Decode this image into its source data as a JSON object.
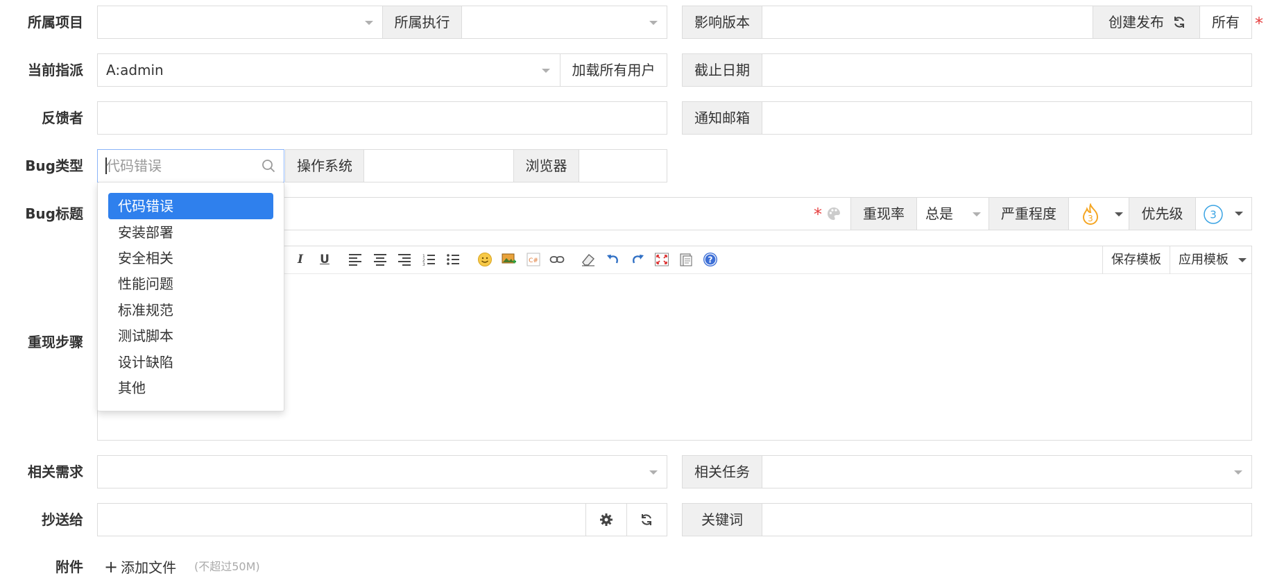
{
  "form": {
    "project": {
      "label": "所属项目",
      "value": ""
    },
    "execution": {
      "label": "所属执行",
      "value": ""
    },
    "affected_version": {
      "label": "影响版本",
      "value": "",
      "create_release": "创建发布",
      "all": "所有"
    },
    "assigned": {
      "label": "当前指派",
      "value": "A:admin",
      "load_all_users": "加载所有用户"
    },
    "deadline": {
      "label": "截止日期",
      "value": ""
    },
    "feedback_by": {
      "label": "反馈者",
      "value": ""
    },
    "notify_email": {
      "label": "通知邮箱",
      "value": ""
    },
    "bug_type": {
      "label": "Bug类型",
      "placeholder": "代码错误"
    },
    "os": {
      "label": "操作系统",
      "value": ""
    },
    "browser": {
      "label": "浏览器",
      "value": ""
    },
    "bug_title": {
      "label": "Bug标题",
      "value": ""
    },
    "reproduce_rate": {
      "label": "重现率",
      "value": "总是"
    },
    "severity": {
      "label": "严重程度",
      "value": "3"
    },
    "priority": {
      "label": "优先级",
      "value": "3"
    },
    "steps": {
      "label": "重现步骤",
      "save_template": "保存模板",
      "apply_template": "应用模板"
    },
    "related_story": {
      "label": "相关需求",
      "value": ""
    },
    "related_task": {
      "label": "相关任务",
      "value": ""
    },
    "cc": {
      "label": "抄送给",
      "value": ""
    },
    "keywords": {
      "label": "关键词",
      "value": ""
    },
    "attachment": {
      "label": "附件",
      "add_file": "添加文件",
      "limit": "(不超过50M)"
    }
  },
  "bug_type_options": [
    "代码错误",
    "安装部署",
    "安全相关",
    "性能问题",
    "标准规范",
    "测试脚本",
    "设计缺陷",
    "其他"
  ],
  "required_mark": "*",
  "colors": {
    "accent": "#2f80ed",
    "required": "#e53e3e",
    "severity_fire": "#f5a623",
    "priority_circle": "#3aa3e3"
  }
}
